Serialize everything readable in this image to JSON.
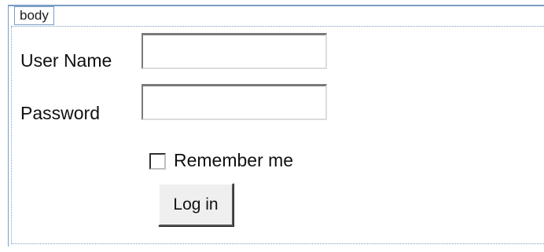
{
  "designer": {
    "tag_label": "body",
    "border_color": "#7b9ec4"
  },
  "login_form": {
    "username_label": "User Name",
    "username_value": "",
    "password_label": "Password",
    "password_value": "",
    "remember_label": "Remember me",
    "remember_checked": false,
    "submit_label": "Log in"
  }
}
